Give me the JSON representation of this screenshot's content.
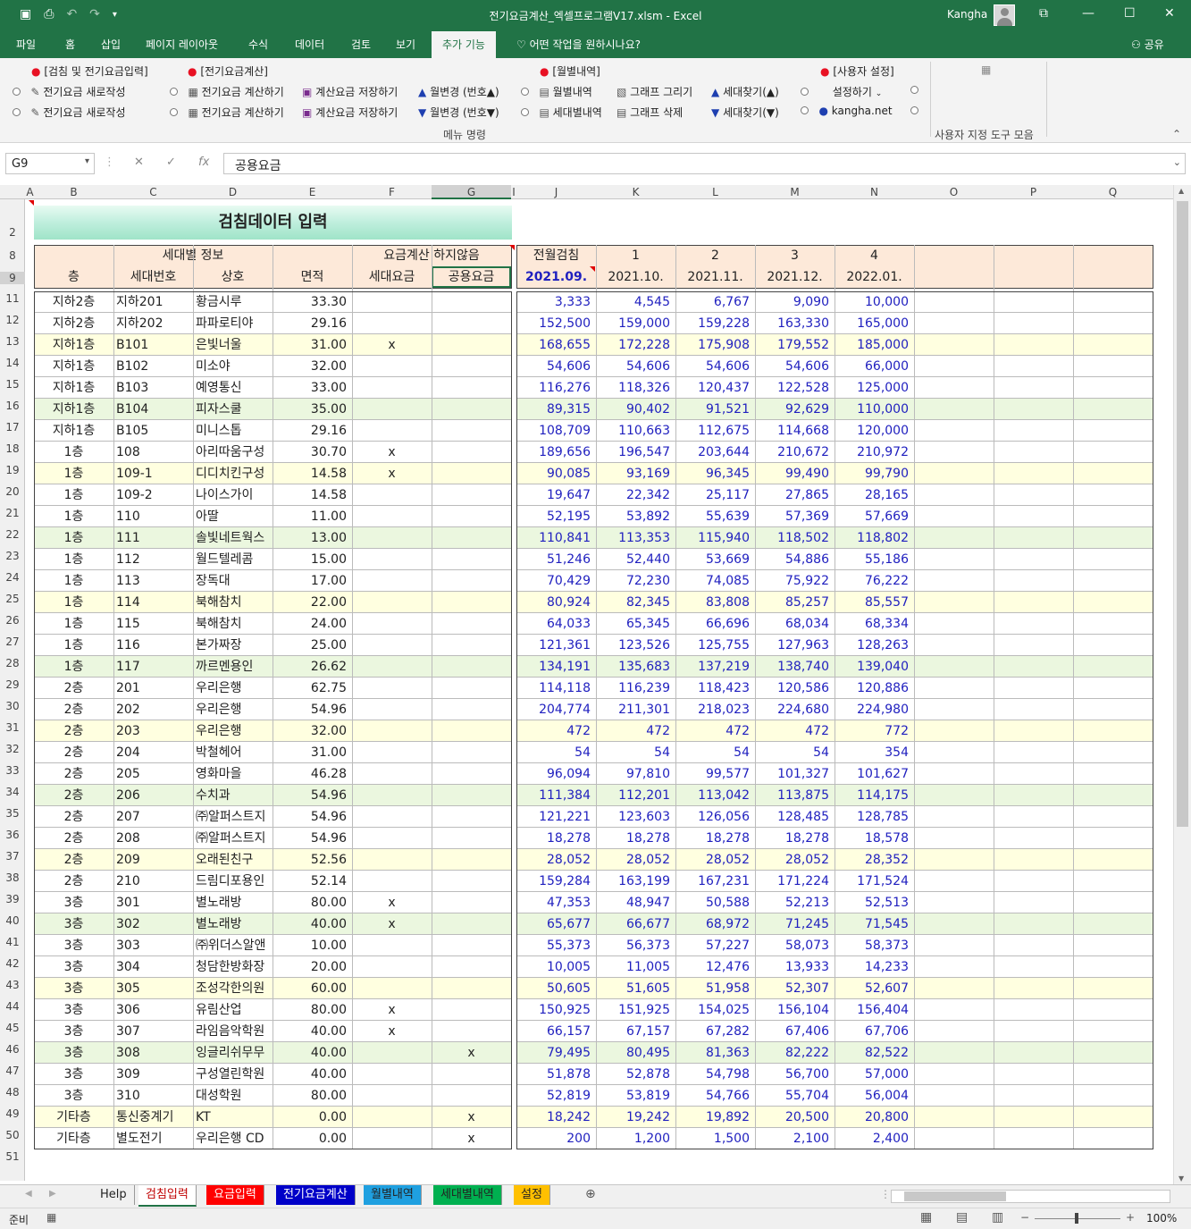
{
  "window": {
    "title": "전기요금계산_엑셀프로그램V17.xlsm  -  Excel",
    "user": "Kangha"
  },
  "tabs": [
    "파일",
    "홈",
    "삽입",
    "페이지 레이아웃",
    "수식",
    "데이터",
    "검토",
    "보기",
    "추가 기능"
  ],
  "active_tab": "추가 기능",
  "tellme": "어떤 작업을 원하시나요?",
  "share": "공유",
  "ribbon": {
    "g1_title": "[검침 및 전기요금입력]",
    "g1_item": "전기요금 새로작성",
    "g2_title": "[전기요금계산]",
    "g2_item1": "전기요금 계산하기",
    "g2_item2": "계산요금 저장하기",
    "g2_up": "월변경 (번호▲)",
    "g2_down": "월변경 (번호▼)",
    "g3_title": "[월별내역]",
    "g3_item1": "월별내역",
    "g3_item2": "세대별내역",
    "g3_graph1": "그래프 그리기",
    "g3_graph2": "그래프 삭제",
    "g3_find_up": "세대찾기(▲)",
    "g3_find_down": "세대찾기(▼)",
    "g4_title": "[사용자 설정]",
    "g4_settings": "설정하기",
    "g4_site": "kangha.net",
    "menu_label": "메뉴 명령",
    "toolbar_label": "사용자 지정 도구 모음"
  },
  "formula": {
    "namebox": "G9",
    "fx": "fx",
    "value": "공용요금"
  },
  "columns": [
    "A",
    "B",
    "C",
    "D",
    "E",
    "F",
    "G",
    "I",
    "J",
    "K",
    "L",
    "M",
    "N",
    "O",
    "P",
    "Q"
  ],
  "sheet_title": "검침데이터 입력",
  "header": {
    "group1": "세대별 정보",
    "group2": "요금계산 하지않음",
    "cols": [
      "층",
      "세대번호",
      "상호",
      "면적",
      "세대요금",
      "공용요금"
    ],
    "prev": "전월검침",
    "month_nums": [
      "1",
      "2",
      "3",
      "4"
    ],
    "prev_date": "2021.09.",
    "dates": [
      "2021.10.",
      "2021.11.",
      "2021.12.",
      "2022.01."
    ]
  },
  "row_numbers": [
    "2",
    "8",
    "9",
    "11",
    "12",
    "13",
    "14",
    "15",
    "16",
    "17",
    "18",
    "19",
    "20",
    "21",
    "22",
    "23",
    "24",
    "25",
    "26",
    "27",
    "28",
    "29",
    "30",
    "31",
    "32",
    "33",
    "34",
    "35",
    "36",
    "37",
    "38",
    "39",
    "40",
    "41",
    "42",
    "43",
    "44",
    "45",
    "46",
    "47",
    "48",
    "49",
    "50",
    "51"
  ],
  "rows": [
    {
      "floor": "지하2층",
      "unit": "지하201",
      "name": "황금시루",
      "area": "33.30",
      "f": "",
      "g": "",
      "v": [
        "3,333",
        "4,545",
        "6,767",
        "9,090",
        "10,000"
      ],
      "bg": "w"
    },
    {
      "floor": "지하2층",
      "unit": "지하202",
      "name": "파파로티야",
      "area": "29.16",
      "f": "",
      "g": "",
      "v": [
        "152,500",
        "159,000",
        "159,228",
        "163,330",
        "165,000"
      ],
      "bg": "w"
    },
    {
      "floor": "지하1층",
      "unit": "B101",
      "name": "은빛너울",
      "area": "31.00",
      "f": "x",
      "g": "",
      "v": [
        "168,655",
        "172,228",
        "175,908",
        "179,552",
        "185,000"
      ],
      "bg": "y"
    },
    {
      "floor": "지하1층",
      "unit": "B102",
      "name": "미소야",
      "area": "32.00",
      "f": "",
      "g": "",
      "v": [
        "54,606",
        "54,606",
        "54,606",
        "54,606",
        "66,000"
      ],
      "bg": "w"
    },
    {
      "floor": "지하1층",
      "unit": "B103",
      "name": "예영통신",
      "area": "33.00",
      "f": "",
      "g": "",
      "v": [
        "116,276",
        "118,326",
        "120,437",
        "122,528",
        "125,000"
      ],
      "bg": "w"
    },
    {
      "floor": "지하1층",
      "unit": "B104",
      "name": "피자스쿨",
      "area": "35.00",
      "f": "",
      "g": "",
      "v": [
        "89,315",
        "90,402",
        "91,521",
        "92,629",
        "110,000"
      ],
      "bg": "g"
    },
    {
      "floor": "지하1층",
      "unit": "B105",
      "name": "미니스톱",
      "area": "29.16",
      "f": "",
      "g": "",
      "v": [
        "108,709",
        "110,663",
        "112,675",
        "114,668",
        "120,000"
      ],
      "bg": "w"
    },
    {
      "floor": "1층",
      "unit": "108",
      "name": "아리따움구성",
      "area": "30.70",
      "f": "x",
      "g": "",
      "v": [
        "189,656",
        "196,547",
        "203,644",
        "210,672",
        "210,972"
      ],
      "bg": "w"
    },
    {
      "floor": "1층",
      "unit": "109-1",
      "name": "디디치킨구성",
      "area": "14.58",
      "f": "x",
      "g": "",
      "v": [
        "90,085",
        "93,169",
        "96,345",
        "99,490",
        "99,790"
      ],
      "bg": "y"
    },
    {
      "floor": "1층",
      "unit": "109-2",
      "name": "나이스가이",
      "area": "14.58",
      "f": "",
      "g": "",
      "v": [
        "19,647",
        "22,342",
        "25,117",
        "27,865",
        "28,165"
      ],
      "bg": "w"
    },
    {
      "floor": "1층",
      "unit": "110",
      "name": "아딸",
      "area": "11.00",
      "f": "",
      "g": "",
      "v": [
        "52,195",
        "53,892",
        "55,639",
        "57,369",
        "57,669"
      ],
      "bg": "w"
    },
    {
      "floor": "1층",
      "unit": "111",
      "name": "솔빛네트웍스",
      "area": "13.00",
      "f": "",
      "g": "",
      "v": [
        "110,841",
        "113,353",
        "115,940",
        "118,502",
        "118,802"
      ],
      "bg": "g"
    },
    {
      "floor": "1층",
      "unit": "112",
      "name": "월드텔레콤",
      "area": "15.00",
      "f": "",
      "g": "",
      "v": [
        "51,246",
        "52,440",
        "53,669",
        "54,886",
        "55,186"
      ],
      "bg": "w"
    },
    {
      "floor": "1층",
      "unit": "113",
      "name": "장독대",
      "area": "17.00",
      "f": "",
      "g": "",
      "v": [
        "70,429",
        "72,230",
        "74,085",
        "75,922",
        "76,222"
      ],
      "bg": "w"
    },
    {
      "floor": "1층",
      "unit": "114",
      "name": "북해참치",
      "area": "22.00",
      "f": "",
      "g": "",
      "v": [
        "80,924",
        "82,345",
        "83,808",
        "85,257",
        "85,557"
      ],
      "bg": "y"
    },
    {
      "floor": "1층",
      "unit": "115",
      "name": "북해참치",
      "area": "24.00",
      "f": "",
      "g": "",
      "v": [
        "64,033",
        "65,345",
        "66,696",
        "68,034",
        "68,334"
      ],
      "bg": "w"
    },
    {
      "floor": "1층",
      "unit": "116",
      "name": "본가짜장",
      "area": "25.00",
      "f": "",
      "g": "",
      "v": [
        "121,361",
        "123,526",
        "125,755",
        "127,963",
        "128,263"
      ],
      "bg": "w"
    },
    {
      "floor": "1층",
      "unit": "117",
      "name": "까르멘용인",
      "area": "26.62",
      "f": "",
      "g": "",
      "v": [
        "134,191",
        "135,683",
        "137,219",
        "138,740",
        "139,040"
      ],
      "bg": "g"
    },
    {
      "floor": "2층",
      "unit": "201",
      "name": "우리은행",
      "area": "62.75",
      "f": "",
      "g": "",
      "v": [
        "114,118",
        "116,239",
        "118,423",
        "120,586",
        "120,886"
      ],
      "bg": "w"
    },
    {
      "floor": "2층",
      "unit": "202",
      "name": "우리은행",
      "area": "54.96",
      "f": "",
      "g": "",
      "v": [
        "204,774",
        "211,301",
        "218,023",
        "224,680",
        "224,980"
      ],
      "bg": "w"
    },
    {
      "floor": "2층",
      "unit": "203",
      "name": "우리은행",
      "area": "32.00",
      "f": "",
      "g": "",
      "v": [
        "472",
        "472",
        "472",
        "472",
        "772"
      ],
      "bg": "y"
    },
    {
      "floor": "2층",
      "unit": "204",
      "name": "박철헤어",
      "area": "31.00",
      "f": "",
      "g": "",
      "v": [
        "54",
        "54",
        "54",
        "54",
        "354"
      ],
      "bg": "w"
    },
    {
      "floor": "2층",
      "unit": "205",
      "name": "영화마을",
      "area": "46.28",
      "f": "",
      "g": "",
      "v": [
        "96,094",
        "97,810",
        "99,577",
        "101,327",
        "101,627"
      ],
      "bg": "w"
    },
    {
      "floor": "2층",
      "unit": "206",
      "name": "수치과",
      "area": "54.96",
      "f": "",
      "g": "",
      "v": [
        "111,384",
        "112,201",
        "113,042",
        "113,875",
        "114,175"
      ],
      "bg": "g"
    },
    {
      "floor": "2층",
      "unit": "207",
      "name": "㈜알퍼스트지",
      "area": "54.96",
      "f": "",
      "g": "",
      "v": [
        "121,221",
        "123,603",
        "126,056",
        "128,485",
        "128,785"
      ],
      "bg": "w"
    },
    {
      "floor": "2층",
      "unit": "208",
      "name": "㈜알퍼스트지",
      "area": "54.96",
      "f": "",
      "g": "",
      "v": [
        "18,278",
        "18,278",
        "18,278",
        "18,278",
        "18,578"
      ],
      "bg": "w"
    },
    {
      "floor": "2층",
      "unit": "209",
      "name": "오래된친구",
      "area": "52.56",
      "f": "",
      "g": "",
      "v": [
        "28,052",
        "28,052",
        "28,052",
        "28,052",
        "28,352"
      ],
      "bg": "y"
    },
    {
      "floor": "2층",
      "unit": "210",
      "name": "드림디포용인",
      "area": "52.14",
      "f": "",
      "g": "",
      "v": [
        "159,284",
        "163,199",
        "167,231",
        "171,224",
        "171,524"
      ],
      "bg": "w"
    },
    {
      "floor": "3층",
      "unit": "301",
      "name": "별노래방",
      "area": "80.00",
      "f": "x",
      "g": "",
      "v": [
        "47,353",
        "48,947",
        "50,588",
        "52,213",
        "52,513"
      ],
      "bg": "w"
    },
    {
      "floor": "3층",
      "unit": "302",
      "name": "별노래방",
      "area": "40.00",
      "f": "x",
      "g": "",
      "v": [
        "65,677",
        "66,677",
        "68,972",
        "71,245",
        "71,545"
      ],
      "bg": "g"
    },
    {
      "floor": "3층",
      "unit": "303",
      "name": "㈜위더스알앤",
      "area": "10.00",
      "f": "",
      "g": "",
      "v": [
        "55,373",
        "56,373",
        "57,227",
        "58,073",
        "58,373"
      ],
      "bg": "w"
    },
    {
      "floor": "3층",
      "unit": "304",
      "name": "청담한방화장",
      "area": "20.00",
      "f": "",
      "g": "",
      "v": [
        "10,005",
        "11,005",
        "12,476",
        "13,933",
        "14,233"
      ],
      "bg": "w"
    },
    {
      "floor": "3층",
      "unit": "305",
      "name": "조성각한의원",
      "area": "60.00",
      "f": "",
      "g": "",
      "v": [
        "50,605",
        "51,605",
        "51,958",
        "52,307",
        "52,607"
      ],
      "bg": "y"
    },
    {
      "floor": "3층",
      "unit": "306",
      "name": "유림산업",
      "area": "80.00",
      "f": "x",
      "g": "",
      "v": [
        "150,925",
        "151,925",
        "154,025",
        "156,104",
        "156,404"
      ],
      "bg": "w"
    },
    {
      "floor": "3층",
      "unit": "307",
      "name": "라임음악학원",
      "area": "40.00",
      "f": "x",
      "g": "",
      "v": [
        "66,157",
        "67,157",
        "67,282",
        "67,406",
        "67,706"
      ],
      "bg": "w"
    },
    {
      "floor": "3층",
      "unit": "308",
      "name": "잉글리쉬무무",
      "area": "40.00",
      "f": "",
      "g": "x",
      "v": [
        "79,495",
        "80,495",
        "81,363",
        "82,222",
        "82,522"
      ],
      "bg": "g"
    },
    {
      "floor": "3층",
      "unit": "309",
      "name": "구성열린학원",
      "area": "40.00",
      "f": "",
      "g": "",
      "v": [
        "51,878",
        "52,878",
        "54,798",
        "56,700",
        "57,000"
      ],
      "bg": "w"
    },
    {
      "floor": "3층",
      "unit": "310",
      "name": "대성학원",
      "area": "80.00",
      "f": "",
      "g": "",
      "v": [
        "52,819",
        "53,819",
        "54,766",
        "55,704",
        "56,004"
      ],
      "bg": "w"
    },
    {
      "floor": "기타층",
      "unit": "통신중계기",
      "name": "KT",
      "area": "0.00",
      "f": "",
      "g": "x",
      "v": [
        "18,242",
        "19,242",
        "19,892",
        "20,500",
        "20,800"
      ],
      "bg": "y"
    },
    {
      "floor": "기타층",
      "unit": "별도전기",
      "name": "우리은행 CD",
      "area": "0.00",
      "f": "",
      "g": "x",
      "v": [
        "200",
        "1,200",
        "1,500",
        "2,100",
        "2,400"
      ],
      "bg": "w"
    }
  ],
  "sheets": [
    {
      "label": "Help",
      "bg": "#f0f0f0",
      "fg": "#222"
    },
    {
      "label": "검침입력",
      "bg": "#ffffff",
      "fg": "#c00000"
    },
    {
      "label": "요금입력",
      "bg": "#ff0000",
      "fg": "#ffffff"
    },
    {
      "label": "전기요금계산",
      "bg": "#0000c8",
      "fg": "#ffffff"
    },
    {
      "label": "월별내역",
      "bg": "#1fa0e0",
      "fg": "#222222"
    },
    {
      "label": "세대별내역",
      "bg": "#00b050",
      "fg": "#222222"
    },
    {
      "label": "설정",
      "bg": "#ffc000",
      "fg": "#222222"
    }
  ],
  "status": {
    "ready": "준비",
    "zoom": "100%"
  },
  "colors": {
    "yellow": "#ffffe0",
    "green": "#ebf7df",
    "header": "#fde9d9",
    "accent": "#217346"
  }
}
